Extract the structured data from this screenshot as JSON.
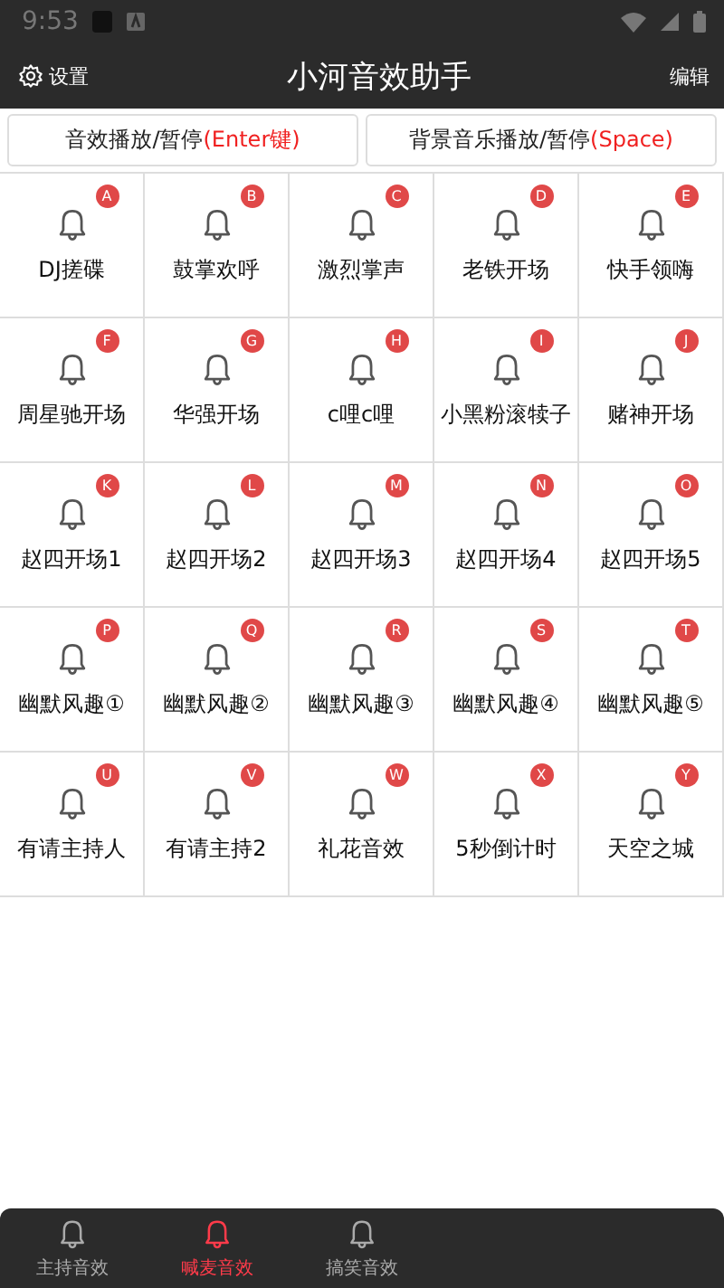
{
  "status_bar": {
    "time": "9:53"
  },
  "header": {
    "settings": "设置",
    "title": "小河音效助手",
    "edit": "编辑"
  },
  "controls": [
    {
      "text": "音效播放/暂停",
      "key": "(Enter键)"
    },
    {
      "text": "背景音乐播放/暂停",
      "key": "(Space)"
    }
  ],
  "sounds": [
    {
      "badge": "A",
      "label": "DJ搓碟"
    },
    {
      "badge": "B",
      "label": "鼓掌欢呼"
    },
    {
      "badge": "C",
      "label": "激烈掌声"
    },
    {
      "badge": "D",
      "label": "老铁开场"
    },
    {
      "badge": "E",
      "label": "快手领嗨"
    },
    {
      "badge": "F",
      "label": "周星驰开场"
    },
    {
      "badge": "G",
      "label": "华强开场"
    },
    {
      "badge": "H",
      "label": "c哩c哩"
    },
    {
      "badge": "I",
      "label": "小黑粉滚犊子"
    },
    {
      "badge": "J",
      "label": "赌神开场"
    },
    {
      "badge": "K",
      "label": "赵四开场1"
    },
    {
      "badge": "L",
      "label": "赵四开场2"
    },
    {
      "badge": "M",
      "label": "赵四开场3"
    },
    {
      "badge": "N",
      "label": "赵四开场4"
    },
    {
      "badge": "O",
      "label": "赵四开场5"
    },
    {
      "badge": "P",
      "label": "幽默风趣①"
    },
    {
      "badge": "Q",
      "label": "幽默风趣②"
    },
    {
      "badge": "R",
      "label": "幽默风趣③"
    },
    {
      "badge": "S",
      "label": "幽默风趣④"
    },
    {
      "badge": "T",
      "label": "幽默风趣⑤"
    },
    {
      "badge": "U",
      "label": "有请主持人"
    },
    {
      "badge": "V",
      "label": "有请主持2"
    },
    {
      "badge": "W",
      "label": "礼花音效"
    },
    {
      "badge": "X",
      "label": "5秒倒计时"
    },
    {
      "badge": "Y",
      "label": "天空之城"
    }
  ],
  "bottom_nav": [
    {
      "label": "主持音效",
      "selected": false
    },
    {
      "label": "喊麦音效",
      "selected": true
    },
    {
      "label": "搞笑音效",
      "selected": false
    }
  ]
}
